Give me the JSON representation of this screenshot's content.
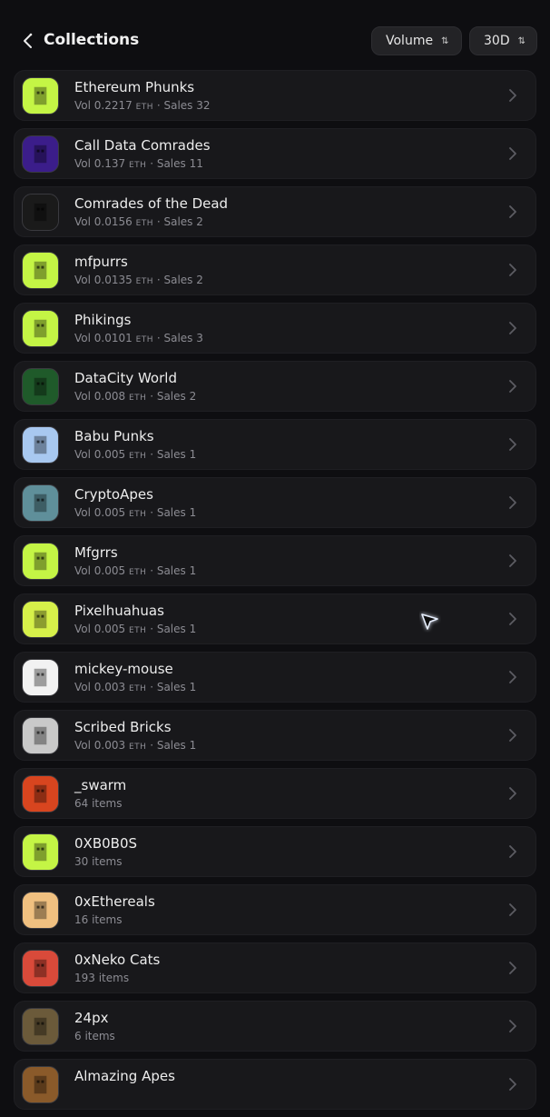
{
  "header": {
    "title": "Collections",
    "sort_label": "Volume",
    "period_label": "30D",
    "sort_icon": "swap-vertical-icon"
  },
  "vol_prefix": "Vol ",
  "eth_unit": "ETH",
  "sales_prefix": " · Sales ",
  "collections": [
    {
      "name": "Ethereum Phunks",
      "vol": "0.2217",
      "sales": "32",
      "thumb": "#c4f545"
    },
    {
      "name": "Call Data Comrades",
      "vol": "0.137",
      "sales": "11",
      "thumb": "#3b1d8a"
    },
    {
      "name": "Comrades of the Dead",
      "vol": "0.0156",
      "sales": "2",
      "thumb": "#1a1a1a"
    },
    {
      "name": "mfpurrs",
      "vol": "0.0135",
      "sales": "2",
      "thumb": "#c4f545"
    },
    {
      "name": "Phikings",
      "vol": "0.0101",
      "sales": "3",
      "thumb": "#c4f545"
    },
    {
      "name": "DataCity World",
      "vol": "0.008",
      "sales": "2",
      "thumb": "#1f5a2a"
    },
    {
      "name": "Babu Punks",
      "vol": "0.005",
      "sales": "1",
      "thumb": "#a8c8f0"
    },
    {
      "name": "CryptoApes",
      "vol": "0.005",
      "sales": "1",
      "thumb": "#5f8f9a"
    },
    {
      "name": "Mfgrrs",
      "vol": "0.005",
      "sales": "1",
      "thumb": "#c4f545"
    },
    {
      "name": "Pixelhuahuas",
      "vol": "0.005",
      "sales": "1",
      "thumb": "#d6f04a"
    },
    {
      "name": "mickey-mouse",
      "vol": "0.003",
      "sales": "1",
      "thumb": "#f2f2f2"
    },
    {
      "name": "Scribed Bricks",
      "vol": "0.003",
      "sales": "1",
      "thumb": "#c9c9c9"
    },
    {
      "name": "_swarm",
      "items": "64 items",
      "thumb": "#d8451f"
    },
    {
      "name": "0XB0B0S",
      "items": "30 items",
      "thumb": "#c4f545"
    },
    {
      "name": "0xEthereals",
      "items": "16 items",
      "thumb": "#f0c080"
    },
    {
      "name": "0xNeko Cats",
      "items": "193 items",
      "thumb": "#d94a3a"
    },
    {
      "name": "24px",
      "items": "6 items",
      "thumb": "#6b5a3a"
    },
    {
      "name": "Almazing Apes",
      "items": "",
      "thumb": "#8a5a2a"
    }
  ]
}
